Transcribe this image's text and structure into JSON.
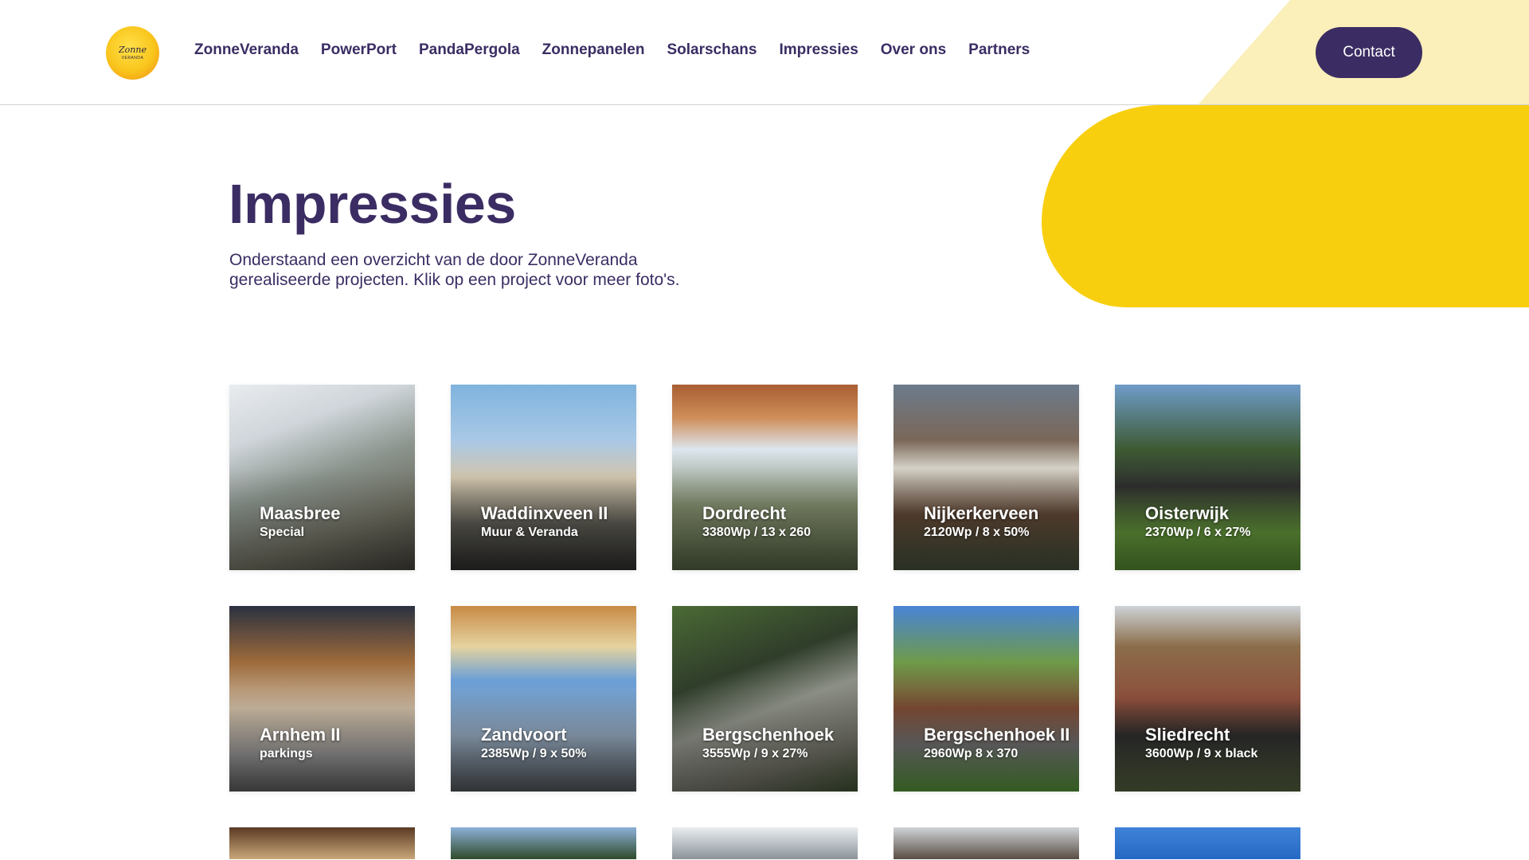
{
  "header": {
    "logo_text": "Zonne",
    "logo_subtext": "VERANDA",
    "nav": [
      "ZonneVeranda",
      "PowerPort",
      "PandaPergola",
      "Zonnepanelen",
      "Solarschans",
      "Impressies",
      "Over ons",
      "Partners"
    ],
    "contact_label": "Contact"
  },
  "main": {
    "title": "Impressies",
    "intro": "Onderstaand een overzicht van de door ZonneVeranda gerealiseerde projecten. Klik op een project voor meer foto's."
  },
  "projects": [
    {
      "title": "Maasbree",
      "subtitle": "Special"
    },
    {
      "title": "Waddinxveen II",
      "subtitle": "Muur & Veranda"
    },
    {
      "title": "Dordrecht",
      "subtitle": "3380Wp / 13 x 260"
    },
    {
      "title": "Nijkerkerveen",
      "subtitle": "2120Wp / 8 x 50%"
    },
    {
      "title": "Oisterwijk",
      "subtitle": "2370Wp / 6 x 27%"
    },
    {
      "title": "Arnhem II",
      "subtitle": "parkings"
    },
    {
      "title": "Zandvoort",
      "subtitle": "2385Wp / 9 x 50%"
    },
    {
      "title": "Bergschenhoek",
      "subtitle": "3555Wp / 9 x 27%"
    },
    {
      "title": "Bergschenhoek II",
      "subtitle": "2960Wp 8 x 370"
    },
    {
      "title": "Sliedrecht",
      "subtitle": "3600Wp / 9 x black"
    }
  ],
  "colors": {
    "brand_purple": "#3b2d63",
    "brand_yellow": "#f8cf0f",
    "light_yellow": "#fbefba"
  }
}
